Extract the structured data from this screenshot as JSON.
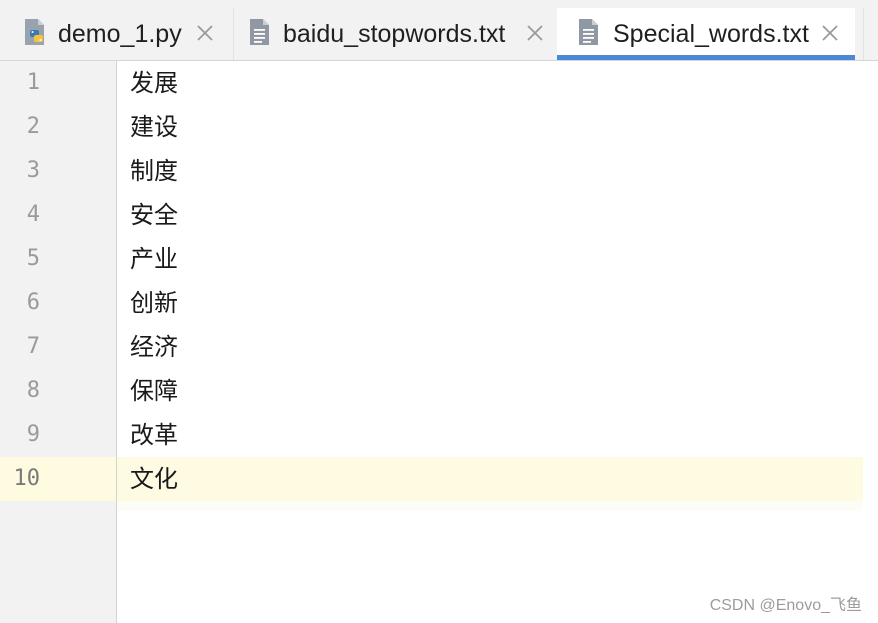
{
  "tabs": [
    {
      "label": "demo_1.py",
      "icon": "python-file-icon",
      "active": false
    },
    {
      "label": "baidu_stopwords.txt",
      "icon": "text-file-icon",
      "active": false
    },
    {
      "label": "Special_words.txt",
      "icon": "text-file-icon",
      "active": true
    }
  ],
  "editor": {
    "current_line": 10,
    "lines": [
      {
        "number": "1",
        "text": "发展"
      },
      {
        "number": "2",
        "text": "建设"
      },
      {
        "number": "3",
        "text": "制度"
      },
      {
        "number": "4",
        "text": "安全"
      },
      {
        "number": "5",
        "text": "产业"
      },
      {
        "number": "6",
        "text": "创新"
      },
      {
        "number": "7",
        "text": "经济"
      },
      {
        "number": "8",
        "text": "保障"
      },
      {
        "number": "9",
        "text": "改革"
      },
      {
        "number": "10",
        "text": "文化"
      }
    ]
  },
  "watermark": "CSDN @Enovo_飞鱼",
  "colors": {
    "active_tab_underline": "#4a87d4",
    "current_line_highlight": "#fffbe3",
    "gutter_background": "#f2f2f2"
  }
}
